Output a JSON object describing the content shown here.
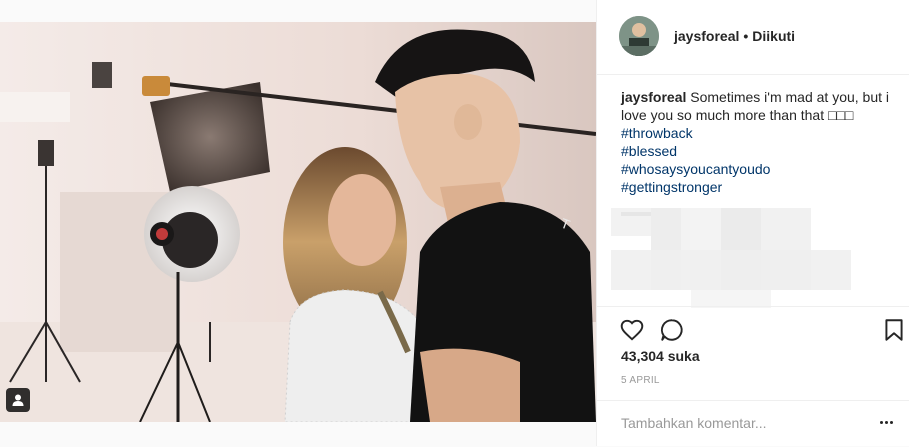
{
  "post": {
    "username": "jaysforeal",
    "separator": "•",
    "follow_status": "Diikuti",
    "caption_text": "Sometimes i'm mad at you, but i love you so much more than that □□□",
    "hashtags": [
      "#throwback",
      "#blessed",
      "#whosaysyoucantyoudo",
      "#gettingstronger"
    ],
    "likes": "43,304 suka",
    "date": "5 APRIL",
    "comment_placeholder": "Tambahkan komentar..."
  },
  "icons": {
    "like": "heart-icon",
    "comment": "comment-bubble-icon",
    "save": "bookmark-icon",
    "more": "more-options-icon",
    "tagged": "user-tag-icon"
  },
  "colors": {
    "hashtag": "#003569",
    "text": "#262626",
    "muted": "#999999",
    "border": "#efefef"
  }
}
